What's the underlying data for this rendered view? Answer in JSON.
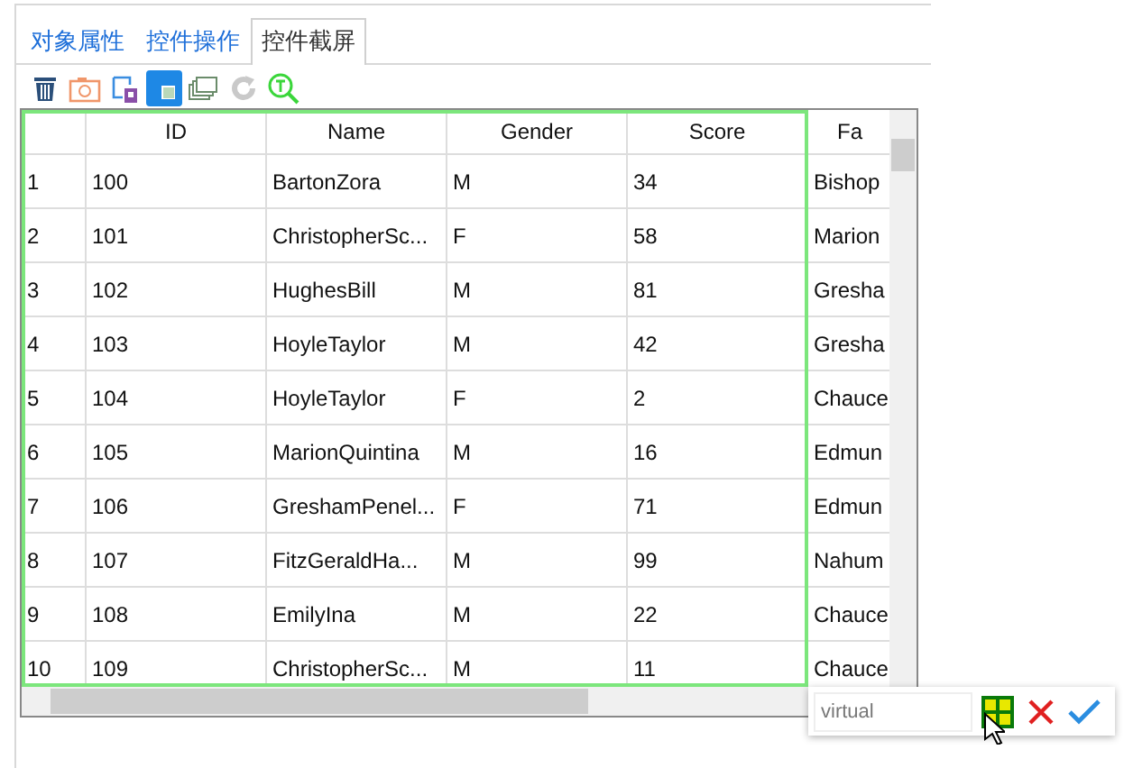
{
  "tabs": [
    {
      "label": "对象属性",
      "selected": false
    },
    {
      "label": "控件操作",
      "selected": false
    },
    {
      "label": "控件截屏",
      "selected": true
    }
  ],
  "toolbar": [
    {
      "kind": "trash",
      "selected": false,
      "disabled": false
    },
    {
      "kind": "camera",
      "selected": false,
      "disabled": false
    },
    {
      "kind": "image",
      "selected": false,
      "disabled": false
    },
    {
      "kind": "square",
      "selected": true,
      "disabled": false
    },
    {
      "kind": "windows",
      "selected": false,
      "disabled": false
    },
    {
      "kind": "refresh",
      "selected": false,
      "disabled": true
    },
    {
      "kind": "search",
      "selected": false,
      "disabled": false
    }
  ],
  "table": {
    "columns": [
      {
        "selected": true
      },
      {
        "label": "ID",
        "selected": true
      },
      {
        "label": "Name",
        "selected": true
      },
      {
        "label": "Gender",
        "selected": true
      },
      {
        "label": "Score",
        "selected": true
      },
      {
        "label": "Fa",
        "selected": false
      }
    ],
    "rows": [
      [
        "1",
        "100",
        "BartonZora",
        "M",
        "34",
        "Bishop"
      ],
      [
        "2",
        "101",
        "ChristopherSc...",
        "F",
        "58",
        "Marion"
      ],
      [
        "3",
        "102",
        "HughesBill",
        "M",
        "81",
        "Gresha"
      ],
      [
        "4",
        "103",
        "HoyleTaylor",
        "M",
        "42",
        "Gresha"
      ],
      [
        "5",
        "104",
        "HoyleTaylor",
        "F",
        "2",
        "Chauce"
      ],
      [
        "6",
        "105",
        "MarionQuintina",
        "M",
        "16",
        "Edmun"
      ],
      [
        "7",
        "106",
        "GreshamPenel...",
        "F",
        "71",
        "Edmun"
      ],
      [
        "8",
        "107",
        "FitzGeraldHa...",
        "M",
        "99",
        "Nahum"
      ],
      [
        "9",
        "108",
        "EmilyIna",
        "M",
        "22",
        "Chauce"
      ],
      [
        "10",
        "109",
        "ChristopherSc...",
        "M",
        "11",
        "Chauce"
      ]
    ]
  },
  "popup": {
    "value": "virtual"
  }
}
